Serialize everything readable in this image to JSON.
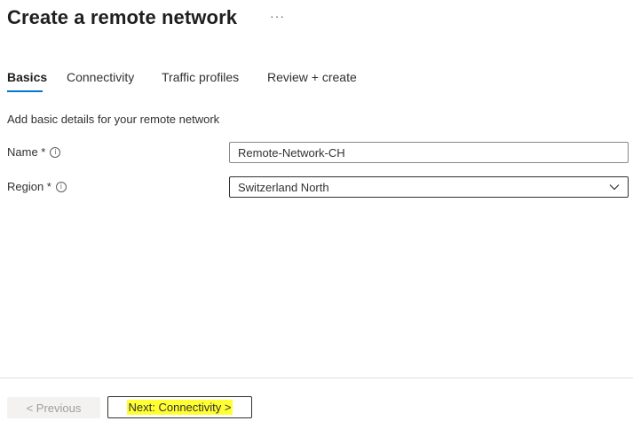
{
  "header": {
    "title": "Create a remote network",
    "more_label": "···"
  },
  "tabs": [
    {
      "label": "Basics",
      "active": true
    },
    {
      "label": "Connectivity",
      "active": false
    },
    {
      "label": "Traffic profiles",
      "active": false
    },
    {
      "label": "Review + create",
      "active": false
    }
  ],
  "form": {
    "description": "Add basic details for your remote network",
    "name": {
      "label": "Name *",
      "value": "Remote-Network-CH"
    },
    "region": {
      "label": "Region *",
      "value": "Switzerland North"
    }
  },
  "footer": {
    "previous_label": "< Previous",
    "next_label": "Next: Connectivity >"
  },
  "colors": {
    "accent": "#0078d4",
    "highlight": "#ffff33"
  }
}
